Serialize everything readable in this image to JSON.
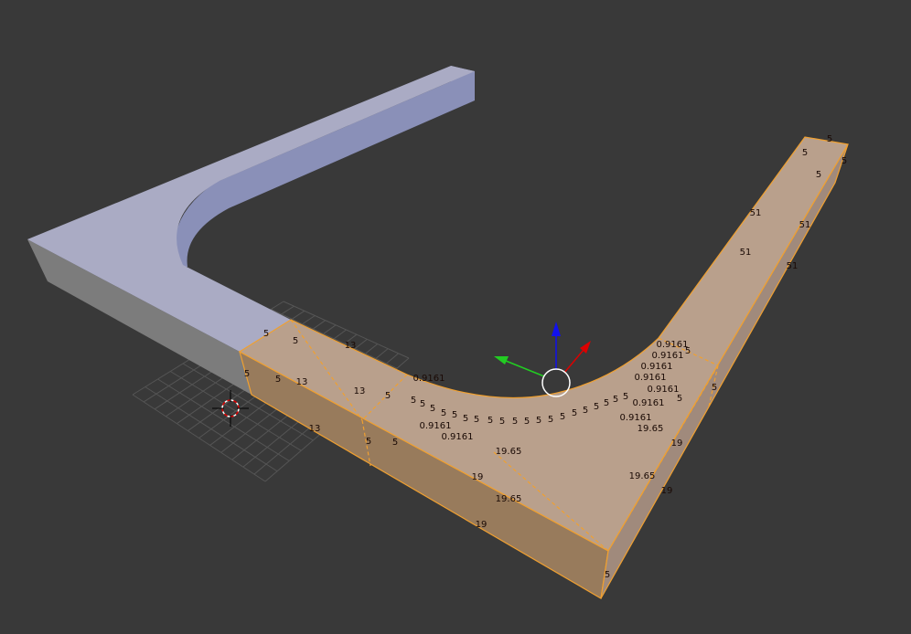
{
  "viewport": {
    "background": "#393939",
    "selection_color": "#f0a030"
  },
  "edge_labels": [
    "5",
    "5",
    "5",
    "5",
    "51",
    "51",
    "51",
    "51",
    "5",
    "5",
    "13",
    "5",
    "5",
    "13",
    "13",
    "13",
    "5",
    "5",
    "5",
    "0.9161",
    "0.9161",
    "0.9161",
    "0.9161",
    "0.9161",
    "0.9161",
    "0.9161",
    "0.9161",
    "0.9161",
    "0.9161",
    "5",
    "5",
    "5",
    "5",
    "5",
    "5",
    "5",
    "5",
    "5",
    "5",
    "5",
    "5",
    "5",
    "5",
    "5",
    "5",
    "5",
    "5",
    "5",
    "5",
    "5",
    "5",
    "5",
    "19.65",
    "19.65",
    "19.65",
    "19.65",
    "19",
    "19",
    "19",
    "19",
    "5"
  ],
  "gizmo": {
    "x_color": "#dd0000",
    "y_color": "#22cc22",
    "z_color": "#1111ee"
  }
}
